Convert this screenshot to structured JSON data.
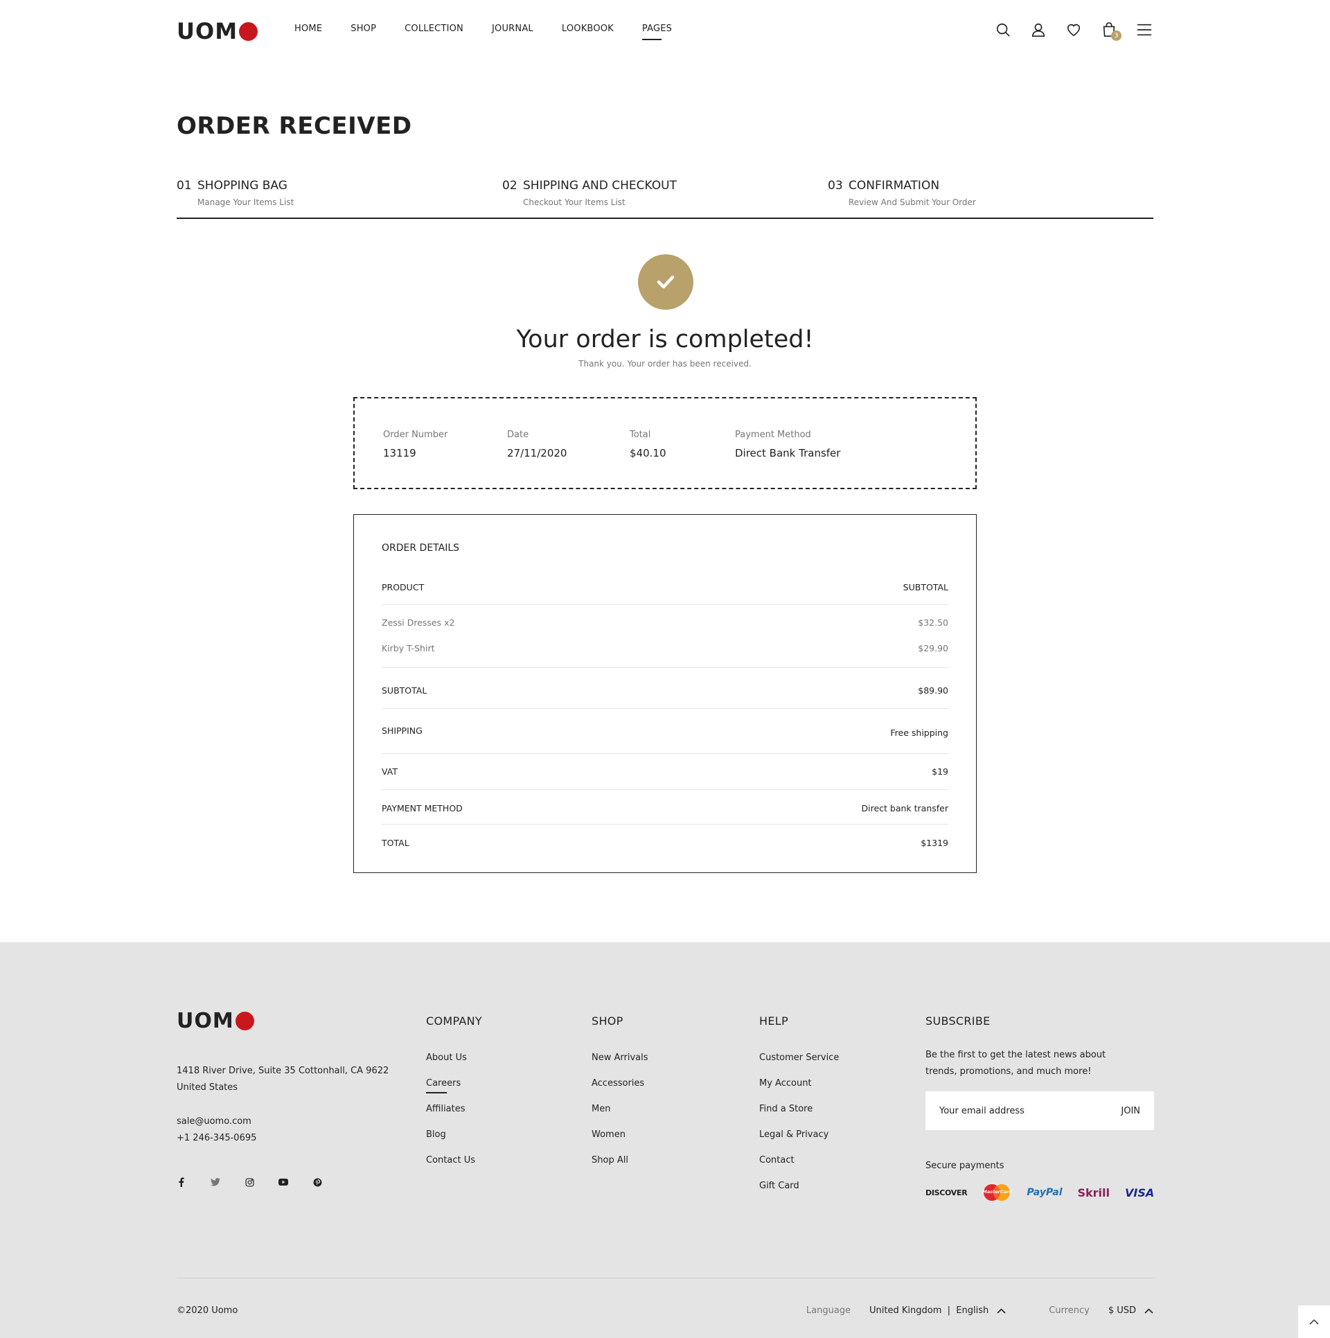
{
  "header": {
    "logo": "UOM",
    "nav": [
      {
        "label": "HOME"
      },
      {
        "label": "SHOP"
      },
      {
        "label": "COLLECTION"
      },
      {
        "label": "JOURNAL"
      },
      {
        "label": "LOOKBOOK"
      },
      {
        "label": "PAGES"
      }
    ],
    "cart_count": "3",
    "icons": [
      "search-icon",
      "user-icon",
      "heart-icon",
      "cart-icon",
      "menu-icon"
    ]
  },
  "page": {
    "title": "ORDER RECEIVED"
  },
  "steps": [
    {
      "num": "01",
      "title": "SHOPPING BAG",
      "sub": "Manage Your Items List"
    },
    {
      "num": "02",
      "title": "SHIPPING AND CHECKOUT",
      "sub": "Checkout Your Items List"
    },
    {
      "num": "03",
      "title": "CONFIRMATION",
      "sub": "Review And Submit Your Order"
    }
  ],
  "success": {
    "title": "Your order is completed!",
    "subtitle": "Thank you. Your order has been received."
  },
  "summary": {
    "order_number_label": "Order Number",
    "order_number": "13119",
    "date_label": "Date",
    "date": "27/11/2020",
    "total_label": "Total",
    "total": "$40.10",
    "payment_label": "Payment Method",
    "payment": "Direct Bank Transfer"
  },
  "details": {
    "title": "ORDER DETAILS",
    "product_header": "PRODUCT",
    "subtotal_header": "SUBTOTAL",
    "items": [
      {
        "name": "Zessi Dresses x2",
        "price": "$32.50"
      },
      {
        "name": "Kirby T-Shirt",
        "price": "$29.90"
      }
    ],
    "subtotal_label": "SUBTOTAL",
    "subtotal": "$89.90",
    "shipping_label": "SHIPPING",
    "shipping": "Free shipping",
    "vat_label": "VAT",
    "vat": "$19",
    "payment_label": "PAYMENT METHOD",
    "payment": "Direct bank transfer",
    "total_label": "TOTAL",
    "total": "$1319"
  },
  "footer": {
    "logo": "UOM",
    "address_line1": "1418 River Drive, Suite 35 Cottonhall, CA 9622",
    "address_line2": "United States",
    "email": "sale@uomo.com",
    "phone": "+1 246-345-0695",
    "social": [
      "facebook-icon",
      "twitter-icon",
      "instagram-icon",
      "youtube-icon",
      "pinterest-icon"
    ],
    "company": {
      "title": "COMPANY",
      "links": [
        "About Us",
        "Careers",
        "Affiliates",
        "Blog",
        "Contact Us"
      ]
    },
    "shop": {
      "title": "SHOP",
      "links": [
        "New Arrivals",
        "Accessories",
        "Men",
        "Women",
        "Shop All"
      ]
    },
    "help": {
      "title": "HELP",
      "links": [
        "Customer Service",
        "My Account",
        "Find a Store",
        "Legal & Privacy",
        "Contact",
        "Gift Card"
      ]
    },
    "subscribe": {
      "title": "SUBSCRIBE",
      "text": "Be the first to get the latest news about trends, promotions, and much more!",
      "placeholder": "Your email address",
      "button": "JOIN",
      "secure_label": "Secure payments",
      "payments": [
        "DISCOVER",
        "MasterCard",
        "PayPal",
        "Skrill",
        "VISA"
      ]
    },
    "copyright": "©2020 Uomo",
    "language_label": "Language",
    "language_value": "United Kingdom  |  English",
    "currency_label": "Currency",
    "currency_value": "$ USD"
  },
  "colors": {
    "accent": "#b9a16b",
    "logo_dot": "#c8181e",
    "footer_bg": "#e4e4e4"
  }
}
